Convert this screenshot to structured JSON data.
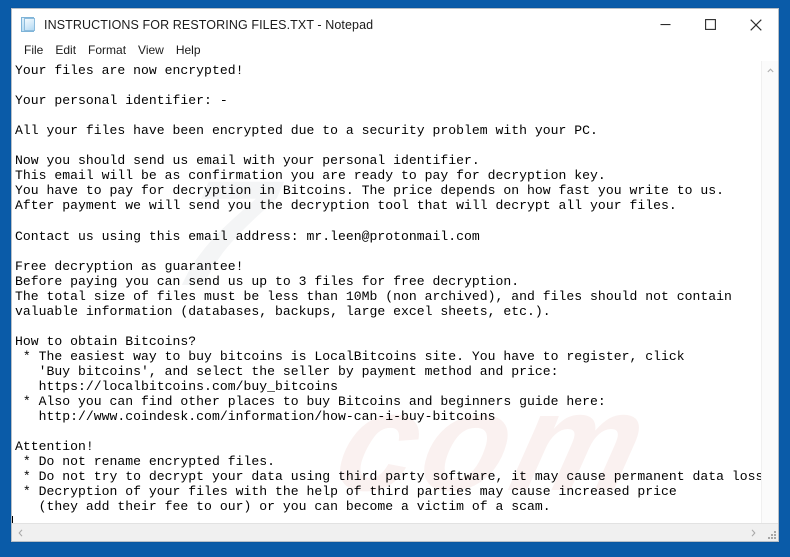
{
  "window": {
    "title": "INSTRUCTIONS FOR RESTORING FILES.TXT - Notepad",
    "icon": "notepad-document-icon",
    "frame_color": "#0a5ba8",
    "titlebar_bg": "#ffffff",
    "controls": {
      "minimize": "minimize-icon",
      "maximize": "maximize-icon",
      "close": "close-icon"
    }
  },
  "menu": {
    "items": [
      {
        "label": "File"
      },
      {
        "label": "Edit"
      },
      {
        "label": "Format"
      },
      {
        "label": "View"
      },
      {
        "label": "Help"
      }
    ]
  },
  "editor": {
    "font": "monospace",
    "text_color": "#000000",
    "background": "#ffffff",
    "caret_visible": true,
    "content": "Your files are now encrypted!\n\nYour personal identifier: -\n\nAll your files have been encrypted due to a security problem with your PC.\n\nNow you should send us email with your personal identifier.\nThis email will be as confirmation you are ready to pay for decryption key.\nYou have to pay for decryption in Bitcoins. The price depends on how fast you write to us.\nAfter payment we will send you the decryption tool that will decrypt all your files.\n\nContact us using this email address: mr.leen@protonmail.com\n\nFree decryption as guarantee!\nBefore paying you can send us up to 3 files for free decryption.\nThe total size of files must be less than 10Mb (non archived), and files should not contain\nvaluable information (databases, backups, large excel sheets, etc.).\n\nHow to obtain Bitcoins?\n * The easiest way to buy bitcoins is LocalBitcoins site. You have to register, click\n   'Buy bitcoins', and select the seller by payment method and price:\n   https://localbitcoins.com/buy_bitcoins\n * Also you can find other places to buy Bitcoins and beginners guide here:\n   http://www.coindesk.com/information/how-can-i-buy-bitcoins\n\nAttention!\n * Do not rename encrypted files.\n * Do not try to decrypt your data using third party software, it may cause permanent data loss.\n * Decryption of your files with the help of third parties may cause increased price\n   (they add their fee to our) or you can become a victim of a scam.",
    "email": "mr.leen@protonmail.com",
    "links": [
      "https://localbitcoins.com/buy_bitcoins",
      "http://www.coindesk.com/information/how-can-i-buy-bitcoins"
    ],
    "watermark": {
      "line1": "7",
      "line2": "com"
    }
  },
  "scrollbars": {
    "vertical": {
      "up": "chevron-up-icon",
      "down": "chevron-down-icon"
    },
    "horizontal": {
      "left": "chevron-left-icon",
      "right": "chevron-right-icon"
    },
    "resize_grip": "resize-grip-icon"
  }
}
